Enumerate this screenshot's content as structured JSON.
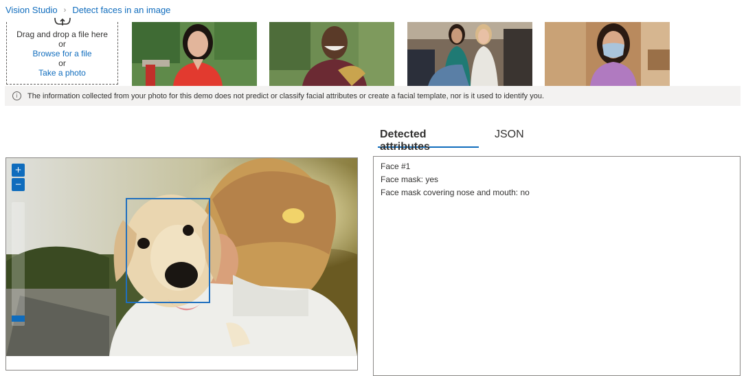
{
  "breadcrumb": {
    "home": "Vision Studio",
    "current": "Detect faces in an image"
  },
  "upload": {
    "drag_text": "Drag and drop a file here",
    "or1": "or",
    "browse_link": "Browse for a file",
    "or2": "or",
    "camera_link": "Take a photo"
  },
  "info": {
    "icon": "info-icon",
    "text": "The information collected from your photo for this demo does not predict or classify facial attributes or create a facial template, nor is it used to identify you."
  },
  "tabs": [
    {
      "label": "Detected attributes",
      "active": true
    },
    {
      "label": "JSON",
      "active": false
    }
  ],
  "viewer": {
    "zoom_in": "+",
    "zoom_out": "−"
  },
  "results": {
    "lines": [
      "Face #1",
      "Face mask: yes",
      "Face mask covering nose and mouth: no"
    ]
  },
  "colors": {
    "accent": "#0f6cbd",
    "info_bg": "#f3f2f1",
    "text": "#323130"
  }
}
